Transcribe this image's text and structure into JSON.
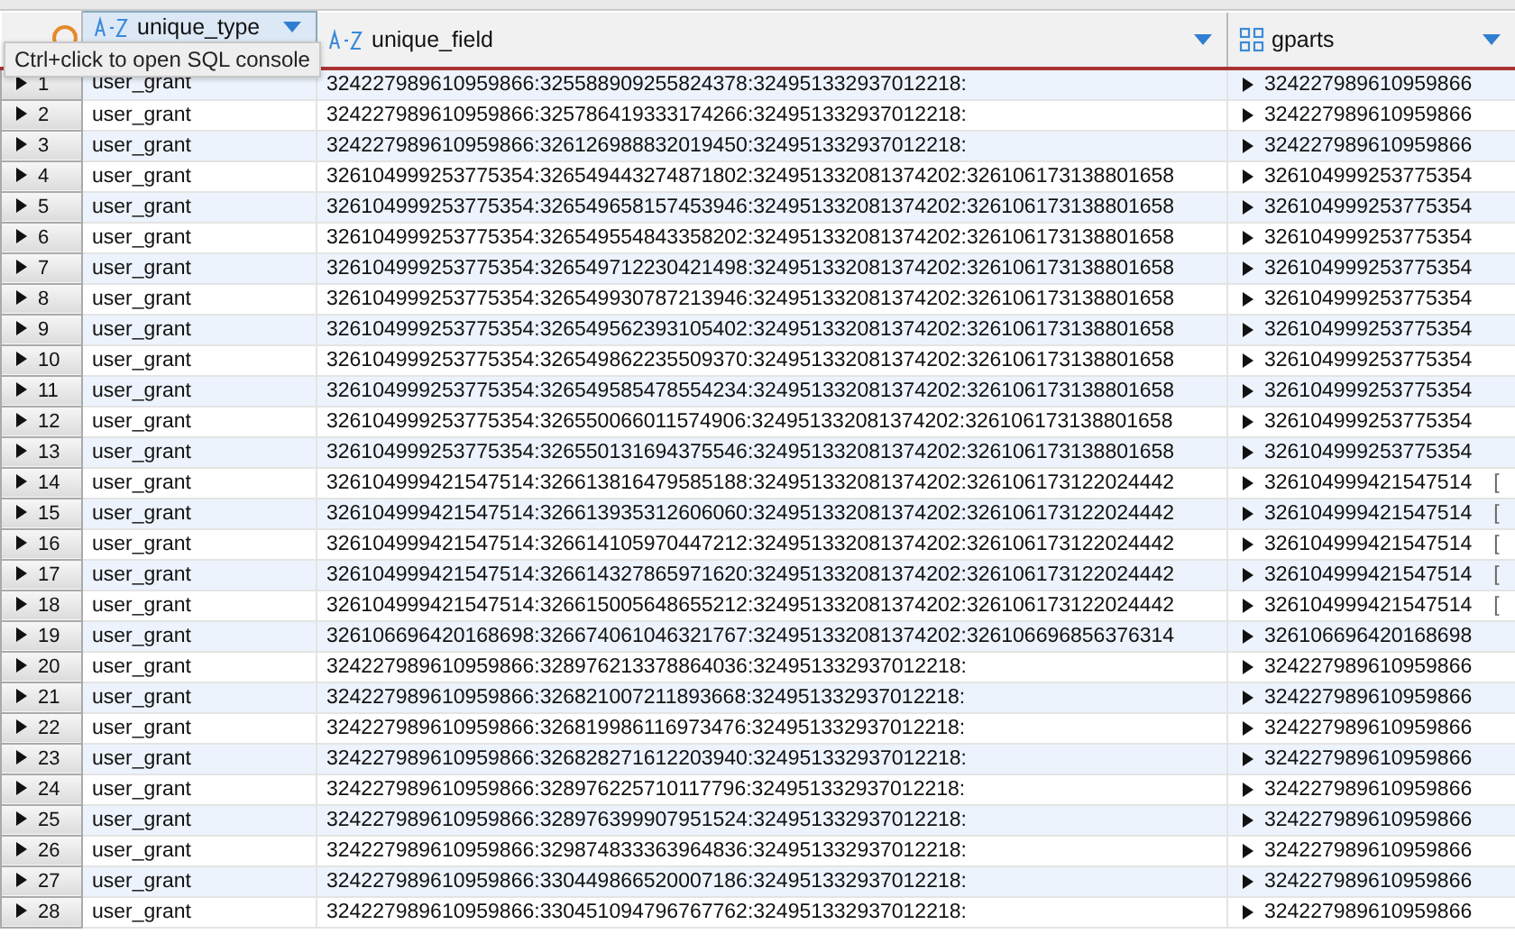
{
  "tooltip": "Ctrl+click to open SQL console",
  "columns": [
    {
      "title": "unique_type",
      "kind": "text",
      "selected": true
    },
    {
      "title": "unique_field",
      "kind": "text",
      "selected": false
    },
    {
      "title": "gparts",
      "kind": "array",
      "selected": false
    }
  ],
  "rows": [
    {
      "number": "1",
      "unique_type": "user_grant",
      "unique_field": "324227989610959866:325588909255824378:324951332937012218:",
      "gparts": "324227989610959866"
    },
    {
      "number": "2",
      "unique_type": "user_grant",
      "unique_field": "324227989610959866:325786419333174266:324951332937012218:",
      "gparts": "324227989610959866"
    },
    {
      "number": "3",
      "unique_type": "user_grant",
      "unique_field": "324227989610959866:326126988832019450:324951332937012218:",
      "gparts": "324227989610959866"
    },
    {
      "number": "4",
      "unique_type": "user_grant",
      "unique_field": "326104999253775354:326549443274871802:324951332081374202:326106173138801658",
      "gparts": "326104999253775354"
    },
    {
      "number": "5",
      "unique_type": "user_grant",
      "unique_field": "326104999253775354:326549658157453946:324951332081374202:326106173138801658",
      "gparts": "326104999253775354"
    },
    {
      "number": "6",
      "unique_type": "user_grant",
      "unique_field": "326104999253775354:326549554843358202:324951332081374202:326106173138801658",
      "gparts": "326104999253775354"
    },
    {
      "number": "7",
      "unique_type": "user_grant",
      "unique_field": "326104999253775354:326549712230421498:324951332081374202:326106173138801658",
      "gparts": "326104999253775354"
    },
    {
      "number": "8",
      "unique_type": "user_grant",
      "unique_field": "326104999253775354:326549930787213946:324951332081374202:326106173138801658",
      "gparts": "326104999253775354"
    },
    {
      "number": "9",
      "unique_type": "user_grant",
      "unique_field": "326104999253775354:326549562393105402:324951332081374202:326106173138801658",
      "gparts": "326104999253775354"
    },
    {
      "number": "10",
      "unique_type": "user_grant",
      "unique_field": "326104999253775354:326549862235509370:324951332081374202:326106173138801658",
      "gparts": "326104999253775354"
    },
    {
      "number": "11",
      "unique_type": "user_grant",
      "unique_field": "326104999253775354:326549585478554234:324951332081374202:326106173138801658",
      "gparts": "326104999253775354"
    },
    {
      "number": "12",
      "unique_type": "user_grant",
      "unique_field": "326104999253775354:326550066011574906:324951332081374202:326106173138801658",
      "gparts": "326104999253775354"
    },
    {
      "number": "13",
      "unique_type": "user_grant",
      "unique_field": "326104999253775354:326550131694375546:324951332081374202:326106173138801658",
      "gparts": "326104999253775354"
    },
    {
      "number": "14",
      "unique_type": "user_grant",
      "unique_field": "326104999421547514:326613816479585188:324951332081374202:326106173122024442",
      "gparts": "326104999421547514",
      "column_4": "["
    },
    {
      "number": "15",
      "unique_type": "user_grant",
      "unique_field": "326104999421547514:326613935312606060:324951332081374202:326106173122024442",
      "gparts": "326104999421547514",
      "column_4": "["
    },
    {
      "number": "16",
      "unique_type": "user_grant",
      "unique_field": "326104999421547514:326614105970447212:324951332081374202:326106173122024442",
      "gparts": "326104999421547514",
      "column_4": "["
    },
    {
      "number": "17",
      "unique_type": "user_grant",
      "unique_field": "326104999421547514:326614327865971620:324951332081374202:326106173122024442",
      "gparts": "326104999421547514",
      "column_4": "["
    },
    {
      "number": "18",
      "unique_type": "user_grant",
      "unique_field": "326104999421547514:326615005648655212:324951332081374202:326106173122024442",
      "gparts": "326104999421547514",
      "column_4": "["
    },
    {
      "number": "19",
      "unique_type": "user_grant",
      "unique_field": "326106696420168698:326674061046321767:324951332081374202:326106696856376314",
      "gparts": "326106696420168698"
    },
    {
      "number": "20",
      "unique_type": "user_grant",
      "unique_field": "324227989610959866:328976213378864036:324951332937012218:",
      "gparts": "324227989610959866"
    },
    {
      "number": "21",
      "unique_type": "user_grant",
      "unique_field": "324227989610959866:326821007211893668:324951332937012218:",
      "gparts": "324227989610959866"
    },
    {
      "number": "22",
      "unique_type": "user_grant",
      "unique_field": "324227989610959866:326819986116973476:324951332937012218:",
      "gparts": "324227989610959866"
    },
    {
      "number": "23",
      "unique_type": "user_grant",
      "unique_field": "324227989610959866:326828271612203940:324951332937012218:",
      "gparts": "324227989610959866"
    },
    {
      "number": "24",
      "unique_type": "user_grant",
      "unique_field": "324227989610959866:328976225710117796:324951332937012218:",
      "gparts": "324227989610959866"
    },
    {
      "number": "25",
      "unique_type": "user_grant",
      "unique_field": "324227989610959866:328976399907951524:324951332937012218:",
      "gparts": "324227989610959866"
    },
    {
      "number": "26",
      "unique_type": "user_grant",
      "unique_field": "324227989610959866:329874833363964836:324951332937012218:",
      "gparts": "324227989610959866"
    },
    {
      "number": "27",
      "unique_type": "user_grant",
      "unique_field": "324227989610959866:330449866520007186:324951332937012218:",
      "gparts": "324227989610959866"
    },
    {
      "number": "28",
      "unique_type": "user_grant",
      "unique_field": "324227989610959866:330451094796767762:324951332937012218:",
      "gparts": "324227989610959866"
    }
  ]
}
